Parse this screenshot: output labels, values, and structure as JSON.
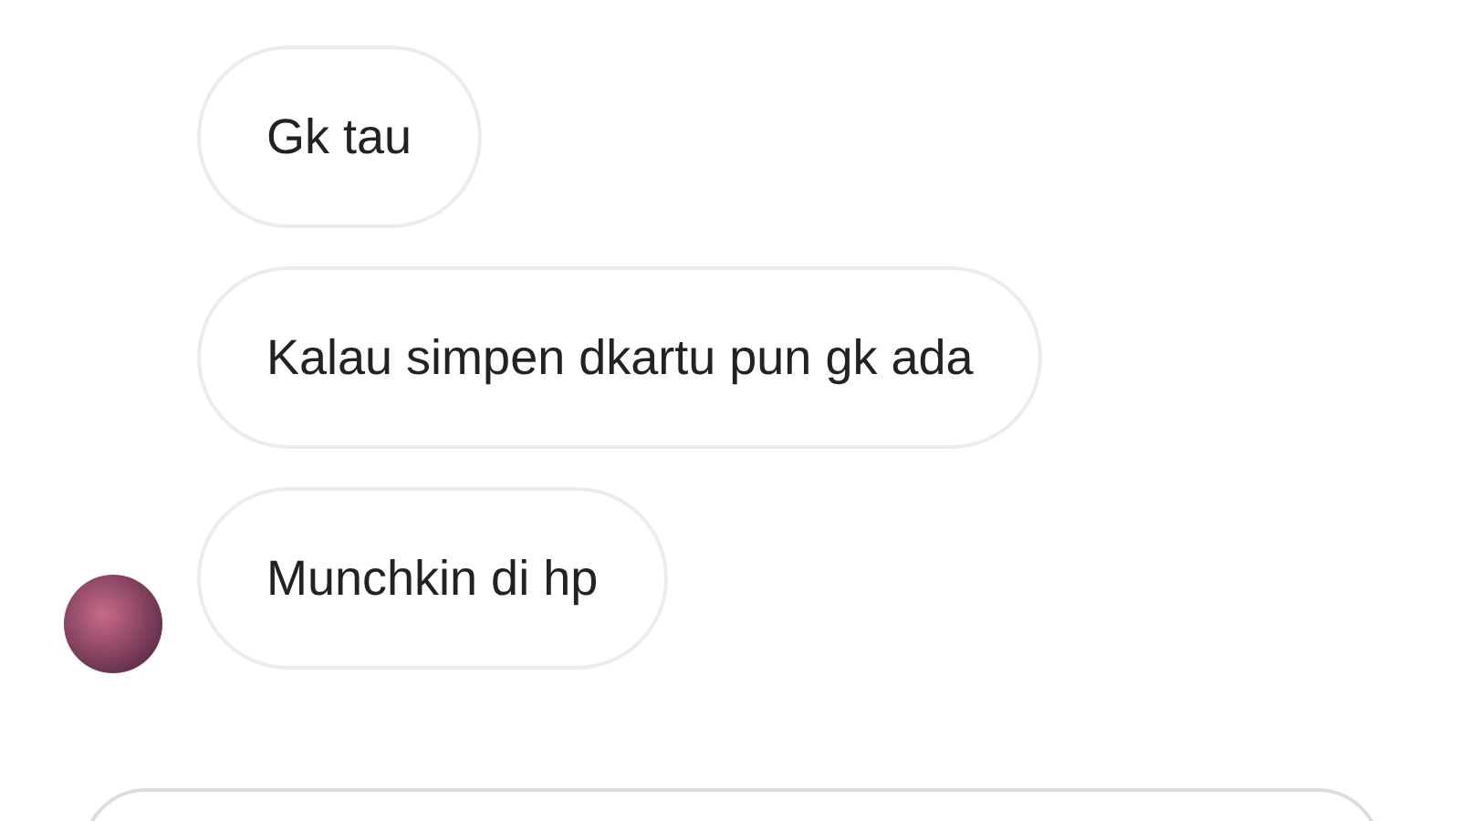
{
  "messages": [
    {
      "text": "Gk tau",
      "avatar": false
    },
    {
      "text": "Kalau simpen dkartu pun gk ada",
      "avatar": false
    },
    {
      "text": "Munchkin di hp",
      "avatar": true
    }
  ]
}
